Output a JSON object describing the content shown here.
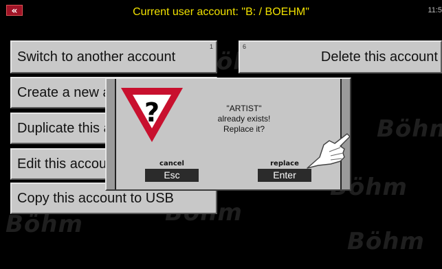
{
  "header": {
    "back_icon": "double-chevron-left-icon",
    "back_glyph": "«",
    "title": "Current user account: \"B: / BOEHM\"",
    "clock": "11:5"
  },
  "watermark": {
    "logo_text": "Böhm"
  },
  "menu": {
    "switch": {
      "label": "Switch to another account",
      "number": "1"
    },
    "delete": {
      "label": "Delete this account",
      "number": "6"
    },
    "create": {
      "label": "Create a new account"
    },
    "duplicate": {
      "label": "Duplicate this account"
    },
    "edit": {
      "label": "Edit this account"
    },
    "copy_usb": {
      "label": "Copy this account to USB"
    }
  },
  "dialog": {
    "icon": "warning-question-icon",
    "message_line1": "\"ARTIST\"",
    "message_line2": "already exists!",
    "message_line3": "Replace it?",
    "cancel_caption": "cancel",
    "cancel_key": "Esc",
    "replace_caption": "replace",
    "replace_key": "Enter",
    "pointer_icon": "pointing-hand-icon"
  },
  "colors": {
    "background": "#000000",
    "title_yellow": "#f2e200",
    "button_gray": "#c8c8c8",
    "warning_red": "#c8102e"
  }
}
